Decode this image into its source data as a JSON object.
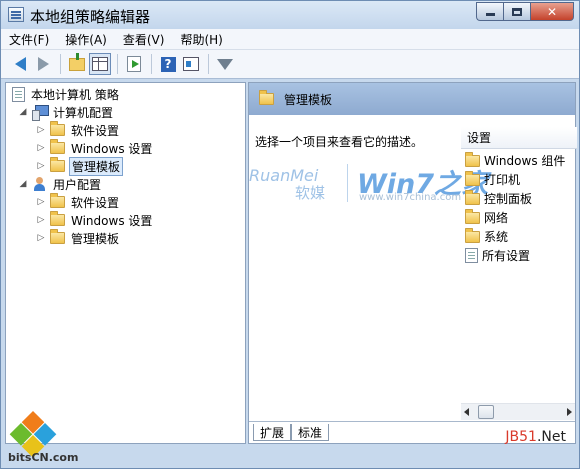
{
  "window": {
    "title": "本地组策略编辑器"
  },
  "menu": [
    "文件(F)",
    "操作(A)",
    "查看(V)",
    "帮助(H)"
  ],
  "tree": {
    "root": "本地计算机 策略",
    "computer": {
      "label": "计算机配置",
      "children": [
        "软件设置",
        "Windows 设置",
        "管理模板"
      ]
    },
    "user": {
      "label": "用户配置",
      "children": [
        "软件设置",
        "Windows 设置",
        "管理模板"
      ]
    }
  },
  "right": {
    "header": "管理模板",
    "description": "选择一个项目来查看它的描述。",
    "column": "设置",
    "items": [
      "Windows 组件",
      "打印机",
      "控制面板",
      "网络",
      "系统",
      "所有设置"
    ]
  },
  "tabs": [
    "扩展",
    "标准"
  ],
  "watermark": {
    "brand_en": "RuanMei",
    "brand_cn": "软媒",
    "site": "Win7之家",
    "url": "www.win7china.com"
  },
  "logos": {
    "left": "bitsCN.com",
    "right_main": "JB51",
    "right_suffix": ".Net"
  },
  "colors": {
    "header": "#8eaad0",
    "window_frame": "#c7d9ed",
    "selection": "#dcebfc"
  }
}
